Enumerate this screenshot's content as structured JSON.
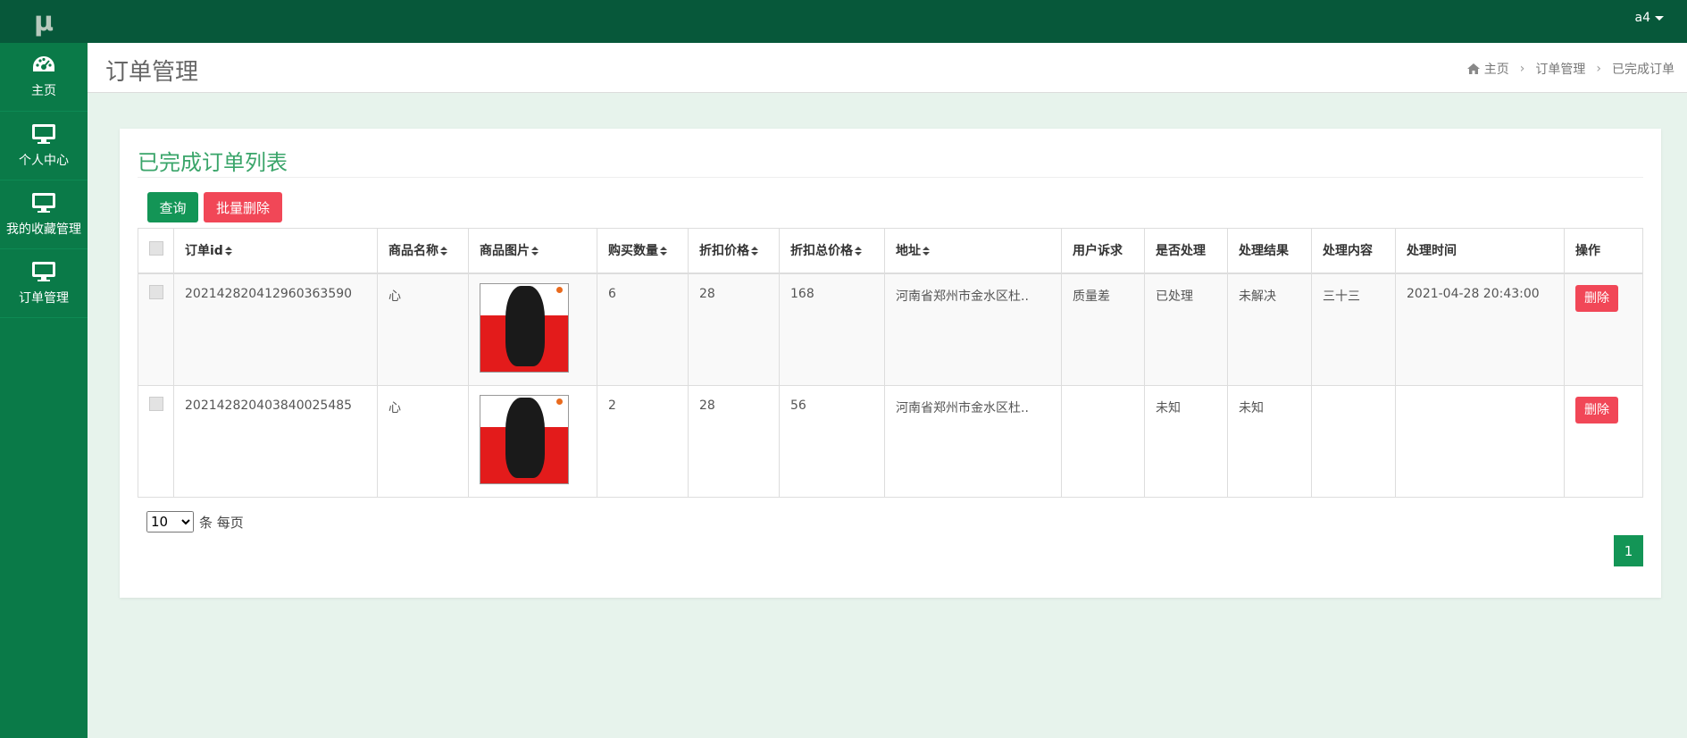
{
  "sidebar": {
    "logo": "μ",
    "items": [
      {
        "label": "主页",
        "icon": "dashboard-icon"
      },
      {
        "label": "个人中心",
        "icon": "monitor-icon"
      },
      {
        "label": "我的收藏管理",
        "icon": "monitor-icon"
      },
      {
        "label": "订单管理",
        "icon": "monitor-icon"
      }
    ]
  },
  "topbar": {
    "user": "a4"
  },
  "header": {
    "title": "订单管理",
    "breadcrumb": [
      "主页",
      "订单管理",
      "已完成订单"
    ]
  },
  "panel": {
    "title": "已完成订单列表",
    "query_label": "查询",
    "batch_delete_label": "批量删除"
  },
  "table": {
    "columns": [
      "订单id",
      "商品名称",
      "商品图片",
      "购买数量",
      "折扣价格",
      "折扣总价格",
      "地址",
      "用户诉求",
      "是否处理",
      "处理结果",
      "处理内容",
      "处理时间",
      "操作"
    ],
    "rows": [
      {
        "order_id": "202142820412960363590",
        "product": "心",
        "qty": "6",
        "price": "28",
        "total": "168",
        "address": "河南省郑州市金水区杜..",
        "appeal": "质量差",
        "handled": "已处理",
        "result": "未解决",
        "content": "三十三",
        "time": "2021-04-28 20:43:00",
        "action": "删除"
      },
      {
        "order_id": "202142820403840025485",
        "product": "心",
        "qty": "2",
        "price": "28",
        "total": "56",
        "address": "河南省郑州市金水区杜..",
        "appeal": "",
        "handled": "未知",
        "result": "未知",
        "content": "",
        "time": "",
        "action": "删除"
      }
    ]
  },
  "pager": {
    "page_size": "10",
    "per_page_label": "条 每页",
    "current_page": "1"
  },
  "colors": {
    "sidebar": "#0a7a48",
    "topbar": "#07583a",
    "accent": "#139556",
    "danger": "#f14757",
    "title": "#3aa56a"
  }
}
